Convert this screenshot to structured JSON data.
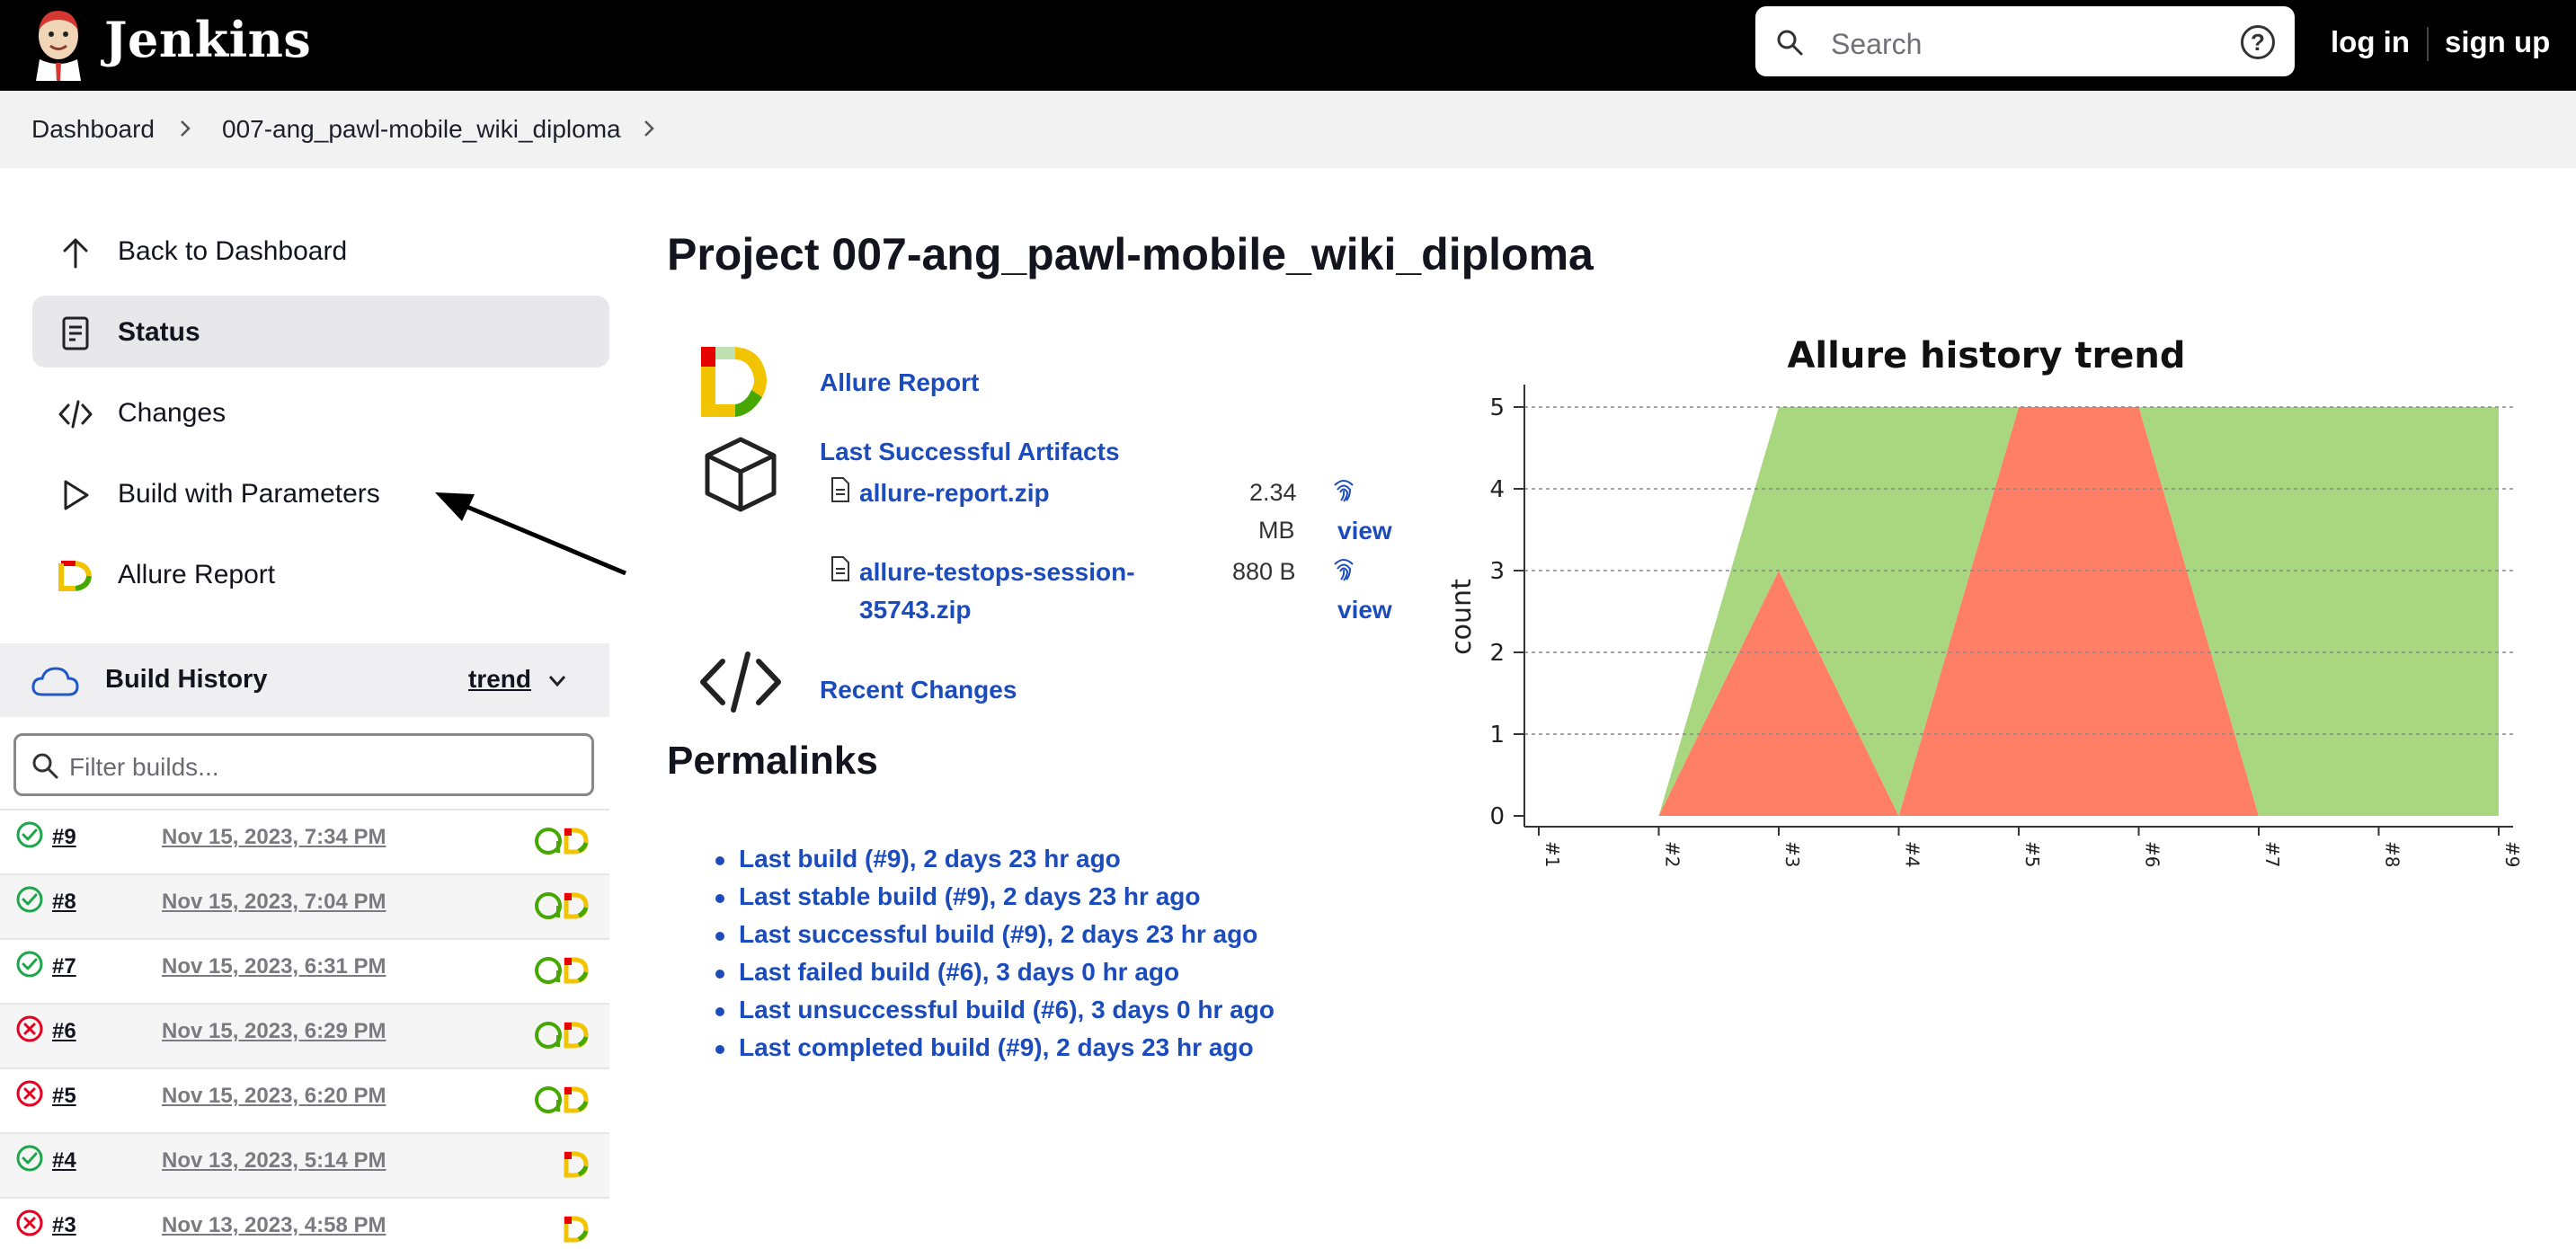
{
  "header": {
    "brand": "Jenkins",
    "search_placeholder": "Search",
    "help_glyph": "?",
    "login": "log in",
    "signup": "sign up"
  },
  "breadcrumb": [
    "Dashboard",
    "007-ang_pawl-mobile_wiki_diploma"
  ],
  "sidebar": {
    "items": [
      {
        "label": "Back to Dashboard",
        "icon": "arrow-up-icon"
      },
      {
        "label": "Status",
        "icon": "document-icon",
        "active": true
      },
      {
        "label": "Changes",
        "icon": "code-icon"
      },
      {
        "label": "Build with Parameters",
        "icon": "play-icon"
      },
      {
        "label": "Allure Report",
        "icon": "allure-icon"
      }
    ]
  },
  "build_history": {
    "title": "Build History",
    "trend": "trend",
    "filter_placeholder": "Filter builds...",
    "builds": [
      {
        "num": "#9",
        "date": "Nov 15, 2023, 7:34 PM",
        "status": "success"
      },
      {
        "num": "#8",
        "date": "Nov 15, 2023, 7:04 PM",
        "status": "success"
      },
      {
        "num": "#7",
        "date": "Nov 15, 2023, 6:31 PM",
        "status": "success"
      },
      {
        "num": "#6",
        "date": "Nov 15, 2023, 6:29 PM",
        "status": "failed"
      },
      {
        "num": "#5",
        "date": "Nov 15, 2023, 6:20 PM",
        "status": "failed"
      },
      {
        "num": "#4",
        "date": "Nov 13, 2023, 5:14 PM",
        "status": "success"
      },
      {
        "num": "#3",
        "date": "Nov 13, 2023, 4:58 PM",
        "status": "failed"
      }
    ]
  },
  "main": {
    "title": "Project 007-ang_pawl-mobile_wiki_diploma",
    "allure_report": "Allure Report",
    "last_artifacts": "Last Successful Artifacts",
    "artifacts": [
      {
        "name": "allure-report.zip",
        "size_num": "2.34",
        "size_unit": "MB",
        "view": "view"
      },
      {
        "name_line1": "allure-testops-session-",
        "name_line2": "35743.zip",
        "size": "880 B",
        "view": "view"
      }
    ],
    "recent_changes": "Recent Changes",
    "permalinks_title": "Permalinks",
    "permalinks": [
      "Last build (#9), 2 days 23 hr ago",
      "Last stable build (#9), 2 days 23 hr ago",
      "Last successful build (#9), 2 days 23 hr ago",
      "Last failed build (#6), 3 days 0 hr ago",
      "Last unsuccessful build (#6), 3 days 0 hr ago",
      "Last completed build (#9), 2 days 23 hr ago"
    ]
  },
  "chart_data": {
    "type": "area",
    "title": "Allure history trend",
    "ylabel": "count",
    "xlabel": "",
    "categories": [
      "#1",
      "#2",
      "#3",
      "#4",
      "#5",
      "#6",
      "#7",
      "#8",
      "#9"
    ],
    "ylim": [
      0,
      5
    ],
    "yticks": [
      0,
      1,
      2,
      3,
      4,
      5
    ],
    "grid": true,
    "series": [
      {
        "color": "#e60000",
        "values": [
          0,
          0,
          3,
          0,
          5,
          5,
          0,
          0,
          0
        ]
      },
      {
        "color": "#45a700",
        "values": [
          0,
          0,
          2,
          5,
          0,
          0,
          5,
          5,
          5
        ]
      }
    ],
    "colors": {
      "failed": "#ff7f66",
      "passed": "#a9d780"
    }
  },
  "colors": {
    "link": "#1c4cbc",
    "success": "#1ea64b",
    "failure": "#e6001f",
    "header_bg": "#000000"
  }
}
